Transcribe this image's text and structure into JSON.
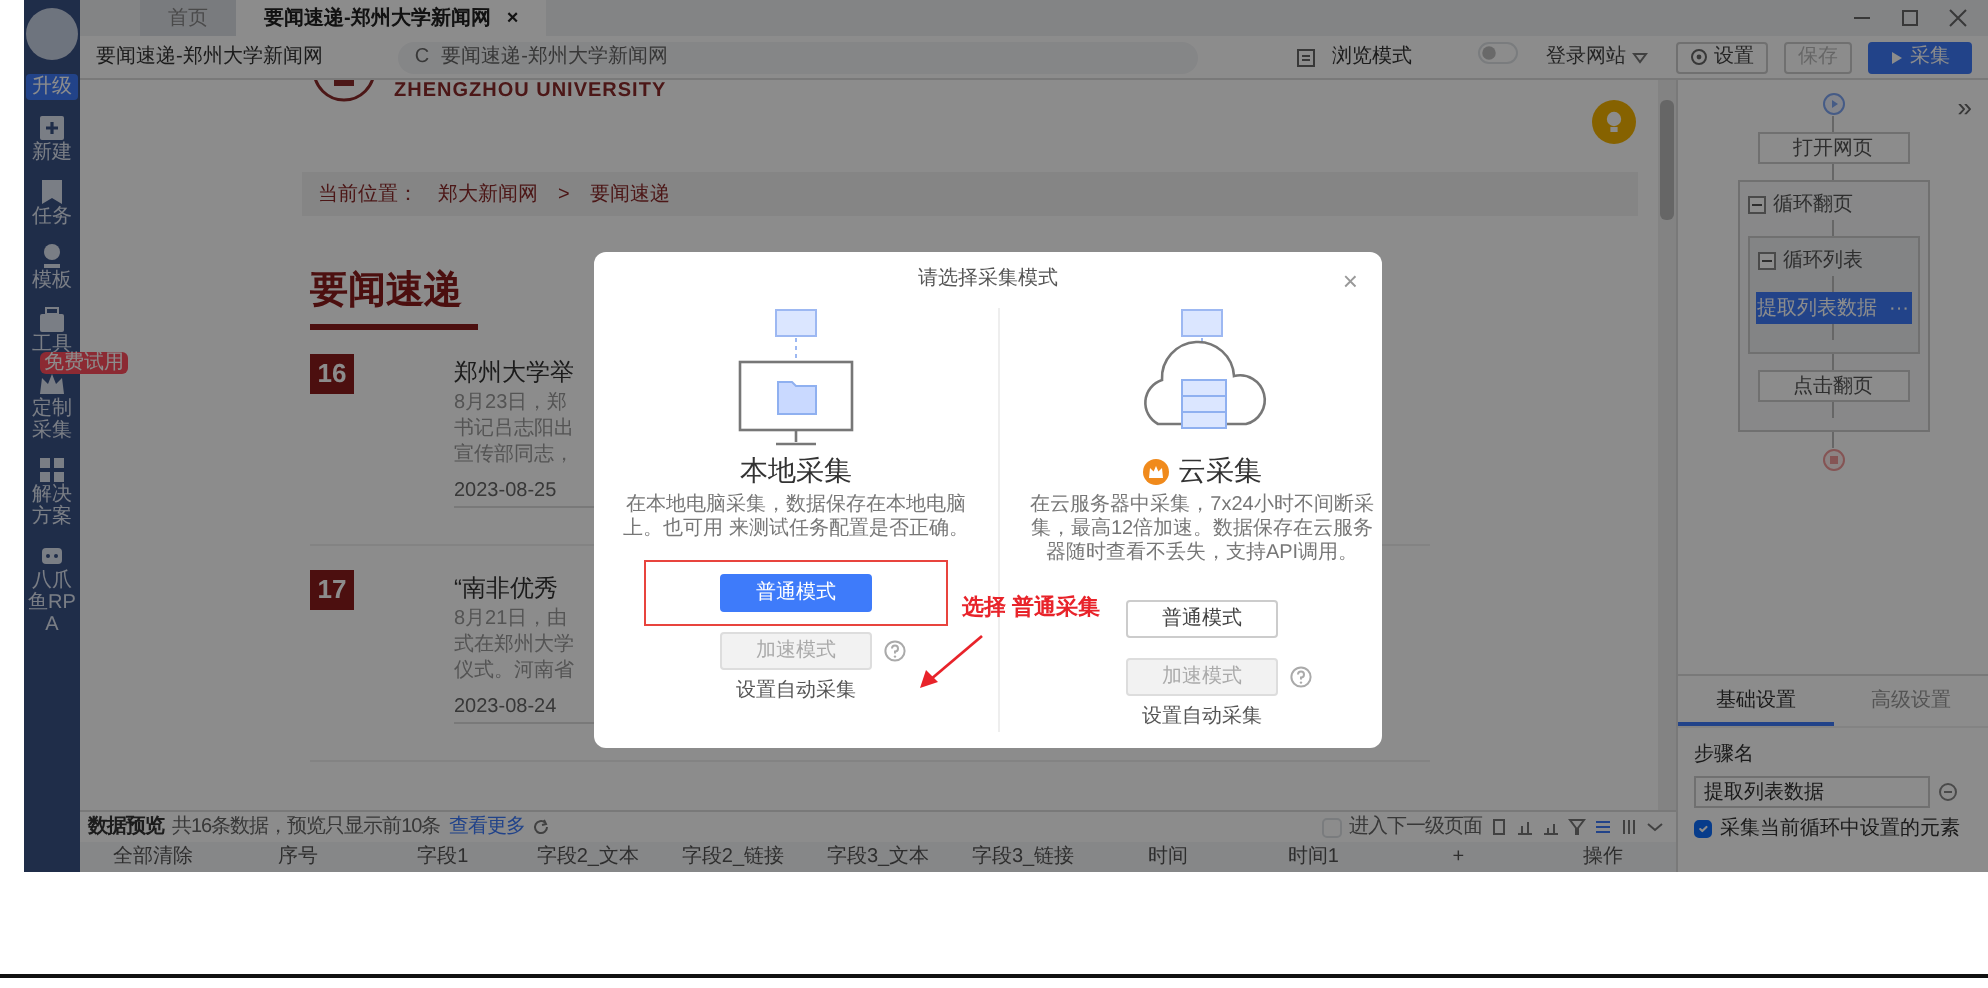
{
  "window": {
    "tabs": [
      {
        "label": "首页",
        "selected": false
      },
      {
        "label": "要闻速递-郑州大学新闻网",
        "selected": true,
        "close": "×"
      }
    ]
  },
  "sidebar": {
    "badge": "升级",
    "items": [
      {
        "label": "新建"
      },
      {
        "label": "任务"
      },
      {
        "label": "模板"
      },
      {
        "label": "工具"
      },
      {
        "label": "定制采集",
        "tag": "免费试用"
      },
      {
        "label": "解决方案"
      },
      {
        "label": "八爪鱼RPA"
      }
    ]
  },
  "toolbar": {
    "page_title": "要闻速递-郑州大学新闻网",
    "reload": "C",
    "address": "要闻速递-郑州大学新闻网",
    "browse_mode": {
      "label": "浏览模式",
      "on": false
    },
    "login": "登录网站",
    "settings": "设置",
    "save": {
      "label": "保存",
      "disabled": true
    },
    "run": "采集"
  },
  "page": {
    "logo_text": "ZHENGZHOU UNIVERSITY",
    "breadcrumb": [
      "当前位置：",
      "郑大新闻网",
      ">",
      "要闻速递"
    ],
    "heading": "要闻速递",
    "news": [
      {
        "number": "16",
        "title": "郑州大学举",
        "lines": [
          "8月23日，郑",
          "书记吕志阳出",
          "宣传部同志，"
        ],
        "date": "2023-08-25"
      },
      {
        "number": "17",
        "title": "“南非优秀",
        "lines": [
          "8月21日，由",
          "式在郑州大学",
          "仪式。河南省"
        ],
        "date": "2023-08-24"
      }
    ]
  },
  "workflow": {
    "collapse": "»",
    "nodes": [
      {
        "kind": "start"
      },
      {
        "kind": "step",
        "label": "打开网页",
        "selected": false
      },
      {
        "kind": "loop",
        "label": "循环翻页",
        "expanded": true,
        "children": [
          {
            "kind": "loop",
            "label": "循环列表",
            "expanded": true,
            "children": [
              {
                "kind": "step",
                "label": "提取列表数据",
                "selected": true,
                "more": "···"
              }
            ]
          },
          {
            "kind": "step",
            "label": "点击翻页",
            "selected": false
          }
        ]
      },
      {
        "kind": "end"
      }
    ]
  },
  "settings": {
    "tabs": [
      {
        "label": "基础设置",
        "selected": true
      },
      {
        "label": "高级设置",
        "selected": false
      }
    ],
    "field_label": "步骤名",
    "field_value": "提取列表数据",
    "checkbox": {
      "label": "采集当前循环中设置的元素",
      "checked": true
    }
  },
  "preview": {
    "title": "数据预览",
    "summary": "共16条数据，预览只显示前10条",
    "more": "查看更多",
    "next_level": {
      "label": "进入下一级页面",
      "checked": false
    },
    "columns": [
      "全部清除",
      "序号",
      "字段1",
      "字段2_文本",
      "字段2_链接",
      "字段3_文本",
      "字段3_链接",
      "时间",
      "时间1",
      "+",
      "操作"
    ]
  },
  "dialog": {
    "title": "请选择采集模式",
    "close": "×",
    "options": [
      {
        "kind": "local",
        "title": "本地采集",
        "description": "在本地电脑采集，数据保存在本地电脑上。也可用 来测试任务配置是否正确。",
        "buttons": [
          {
            "label": "普通模式",
            "primary": true,
            "disabled": false,
            "help": false
          },
          {
            "label": "加速模式",
            "primary": false,
            "disabled": true,
            "help": true
          }
        ],
        "link": "设置自动采集"
      },
      {
        "kind": "cloud",
        "title": "云采集",
        "description": "在云服务器中采集，7x24小时不间断采集，最高12倍加速。数据保存在云服务器随时查看不丢失，支持API调用。",
        "buttons": [
          {
            "label": "普通模式",
            "primary": false,
            "disabled": false,
            "help": false
          },
          {
            "label": "加速模式",
            "primary": false,
            "disabled": true,
            "help": true
          }
        ],
        "link": "设置自动采集"
      }
    ]
  },
  "annotation": {
    "text": "选择 普通采集"
  }
}
